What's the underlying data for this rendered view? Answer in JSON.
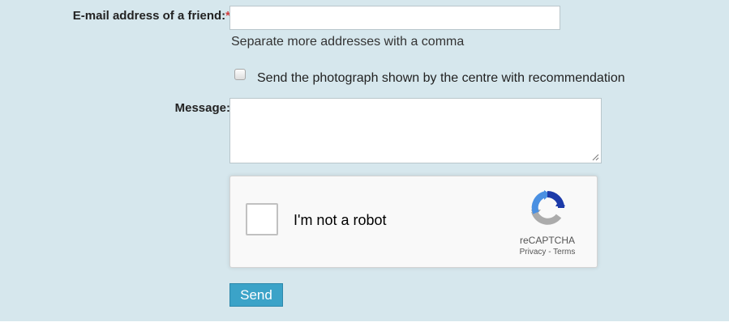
{
  "form": {
    "email": {
      "label": "E-mail address of a friend:",
      "required_marker": "*",
      "value": "",
      "hint": "Separate more addresses with a comma"
    },
    "photo_checkbox": {
      "label": "Send the photograph shown by the centre with recommendation",
      "checked": false
    },
    "message": {
      "label": "Message:",
      "value": ""
    },
    "captcha": {
      "checkbox_label": "I'm not a robot",
      "brand": "reCAPTCHA",
      "privacy_link": "Privacy",
      "separator": " - ",
      "terms_link": "Terms"
    },
    "send_button": "Send"
  },
  "colors": {
    "panel_background": "#d6e7ed",
    "required_marker": "#d23c3c",
    "send_button": "#3ba3c8",
    "captcha_blue": "#1c3aa9",
    "captcha_light_blue": "#4a90e2",
    "captcha_gray": "#ababab"
  }
}
